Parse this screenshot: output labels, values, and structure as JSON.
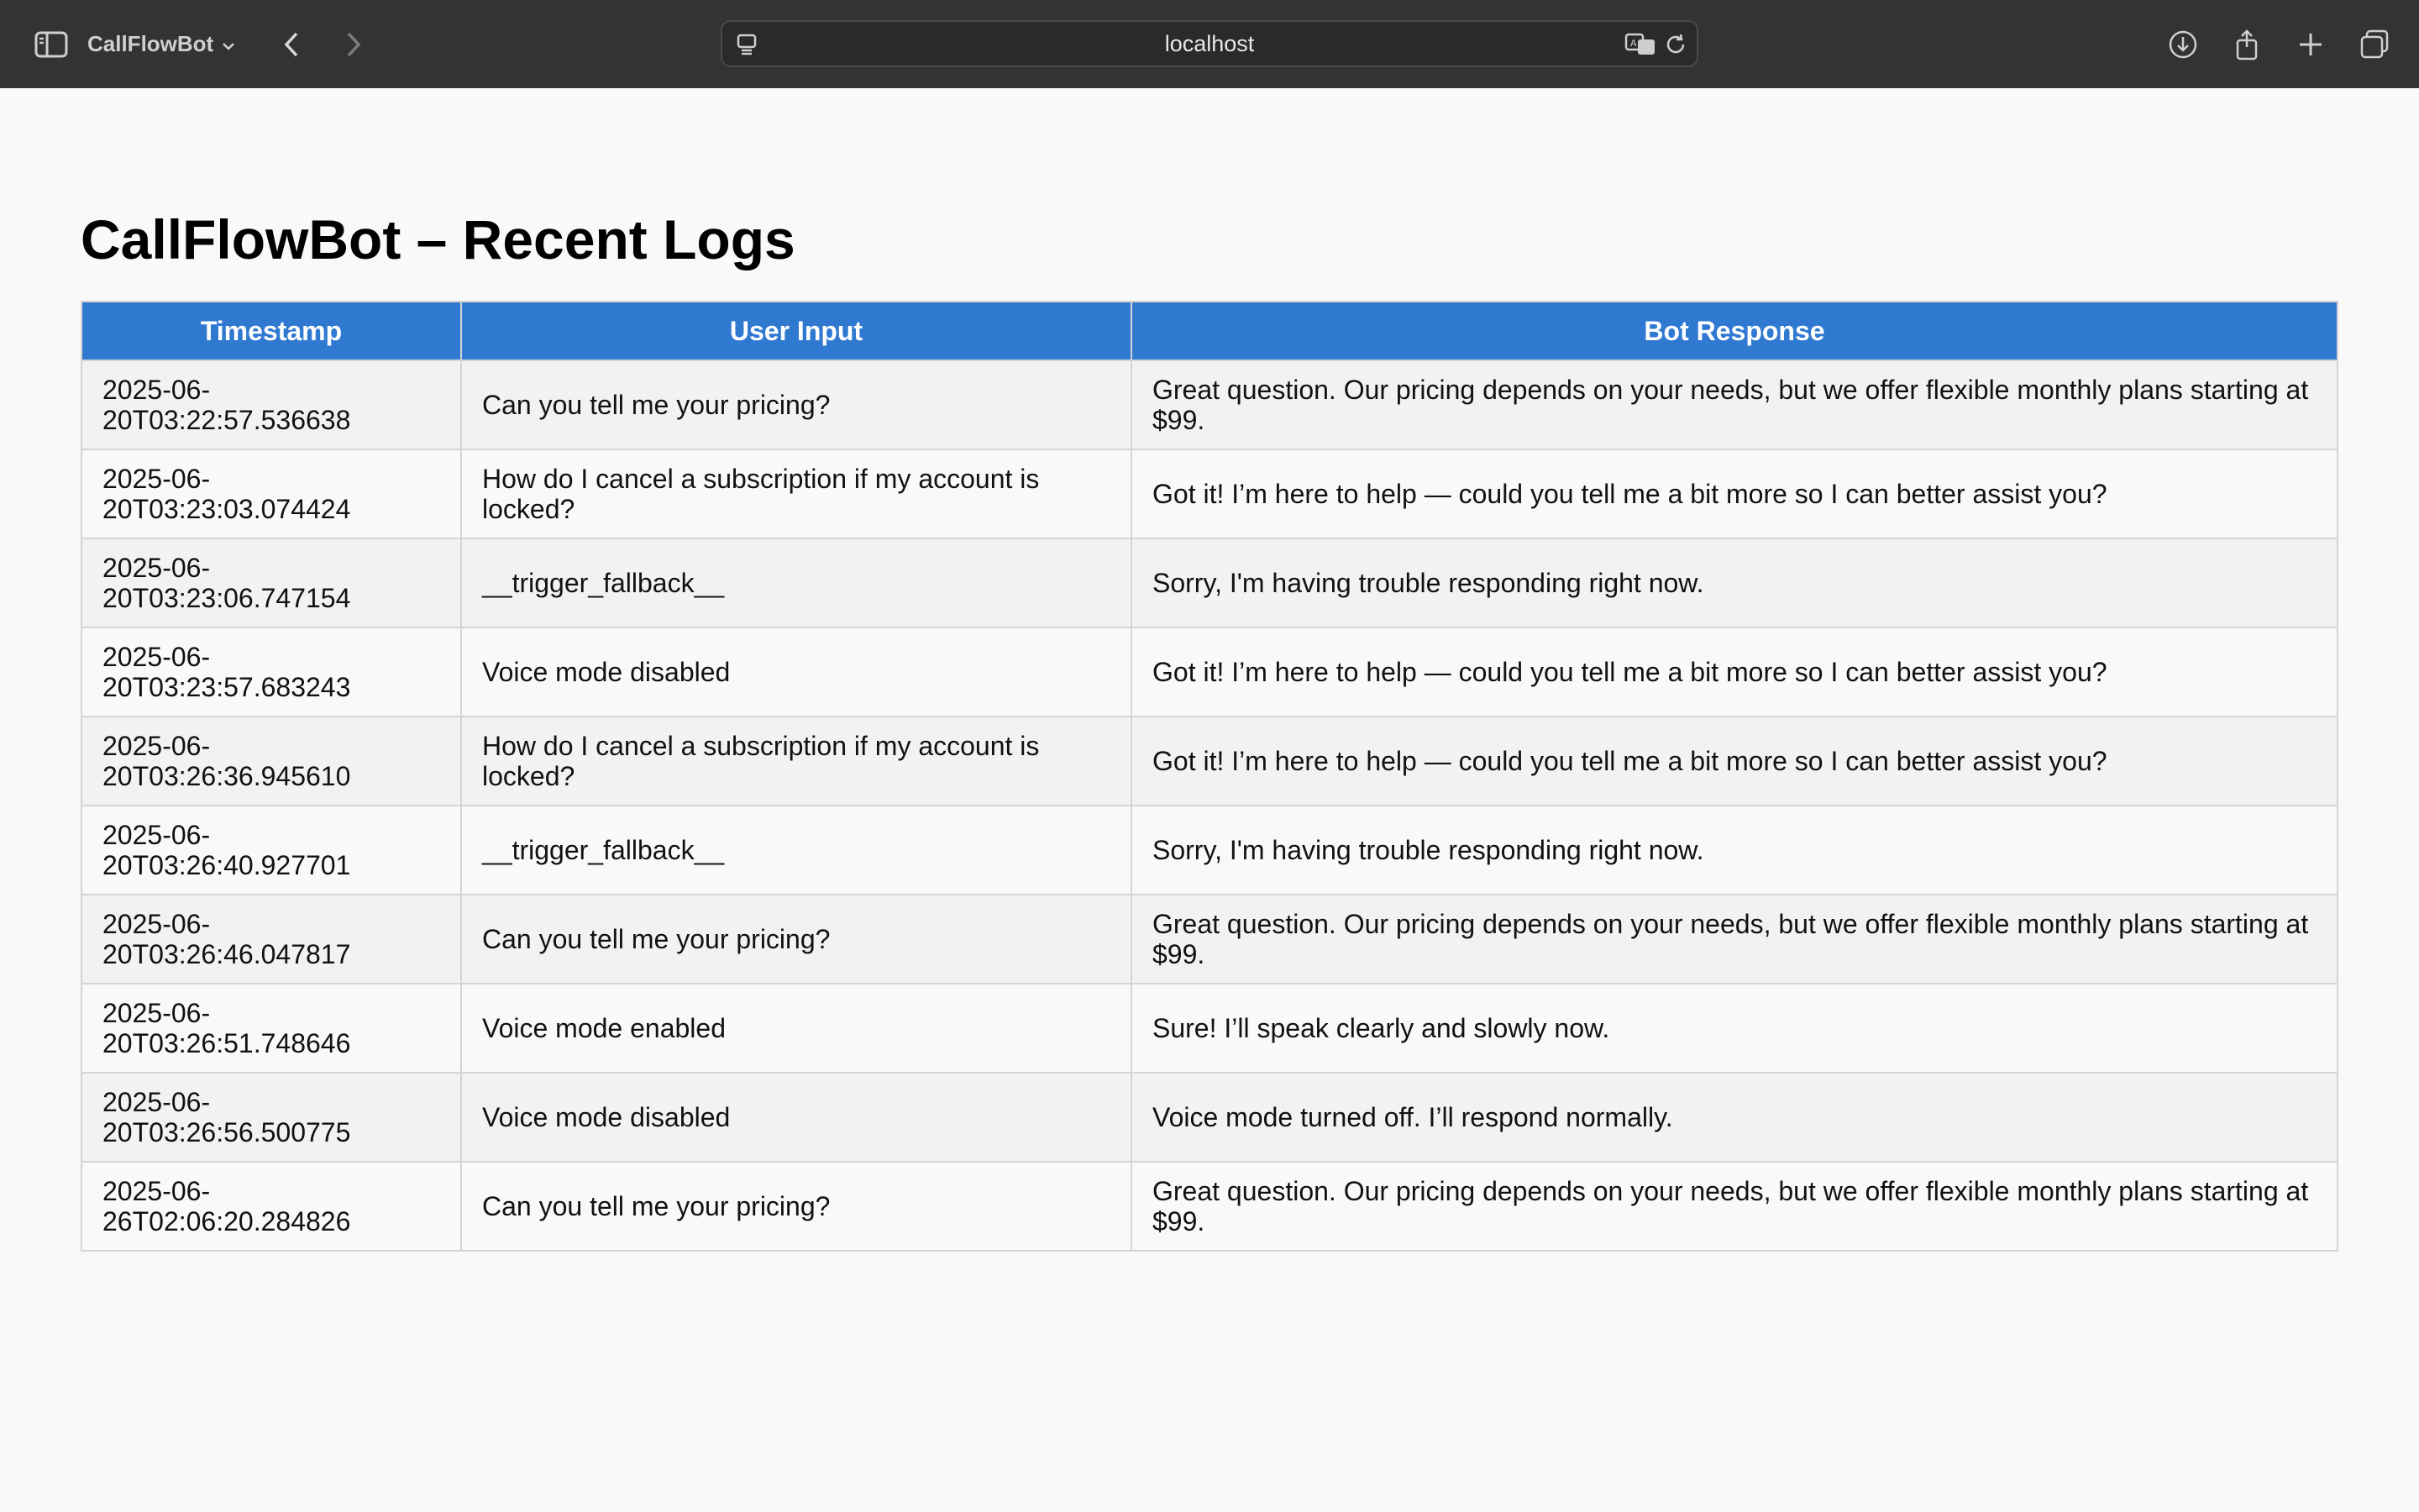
{
  "browser": {
    "app_name": "CallFlowBot",
    "url": "localhost"
  },
  "page": {
    "title": "CallFlowBot – Recent Logs",
    "table": {
      "headers": [
        "Timestamp",
        "User Input",
        "Bot Response"
      ],
      "rows": [
        {
          "timestamp": "2025-06-20T03:22:57.536638",
          "input": "Can you tell me your pricing?",
          "response": "Great question. Our pricing depends on your needs, but we offer flexible monthly plans starting at $99."
        },
        {
          "timestamp": "2025-06-20T03:23:03.074424",
          "input": "How do I cancel a subscription if my account is locked?",
          "response": "Got it! I’m here to help — could you tell me a bit more so I can better assist you?"
        },
        {
          "timestamp": "2025-06-20T03:23:06.747154",
          "input": "__trigger_fallback__",
          "response": "Sorry, I'm having trouble responding right now."
        },
        {
          "timestamp": "2025-06-20T03:23:57.683243",
          "input": "Voice mode disabled",
          "response": "Got it! I’m here to help — could you tell me a bit more so I can better assist you?"
        },
        {
          "timestamp": "2025-06-20T03:26:36.945610",
          "input": "How do I cancel a subscription if my account is locked?",
          "response": "Got it! I’m here to help — could you tell me a bit more so I can better assist you?"
        },
        {
          "timestamp": "2025-06-20T03:26:40.927701",
          "input": "__trigger_fallback__",
          "response": "Sorry, I'm having trouble responding right now."
        },
        {
          "timestamp": "2025-06-20T03:26:46.047817",
          "input": "Can you tell me your pricing?",
          "response": "Great question. Our pricing depends on your needs, but we offer flexible monthly plans starting at $99."
        },
        {
          "timestamp": "2025-06-20T03:26:51.748646",
          "input": "Voice mode enabled",
          "response": "Sure! I’ll speak clearly and slowly now."
        },
        {
          "timestamp": "2025-06-20T03:26:56.500775",
          "input": "Voice mode disabled",
          "response": "Voice mode turned off. I’ll respond normally."
        },
        {
          "timestamp": "2025-06-26T02:06:20.284826",
          "input": "Can you tell me your pricing?",
          "response": "Great question. Our pricing depends on your needs, but we offer flexible monthly plans starting at $99."
        }
      ]
    }
  },
  "colors": {
    "header_bg": "#3079d1",
    "toolbar_bg": "#333333",
    "row_alt": "#f2f2f2"
  }
}
